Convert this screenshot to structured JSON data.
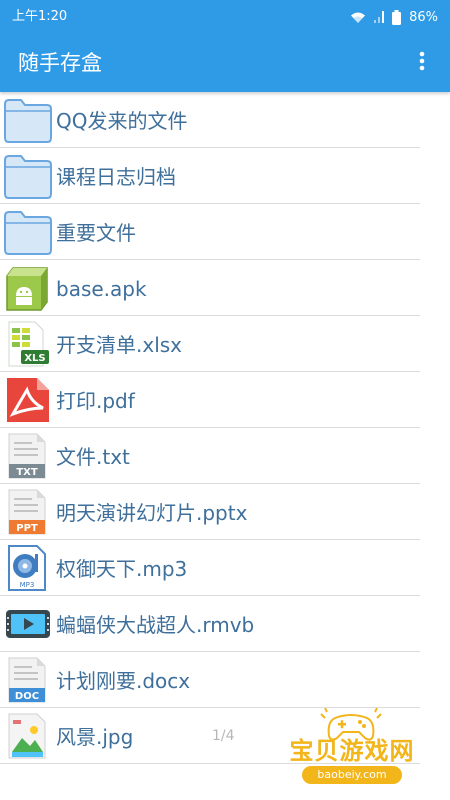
{
  "status_bar": {
    "time": "上午1:20",
    "battery": "86%",
    "icons": [
      "wifi-icon",
      "signal-icon",
      "battery-icon"
    ]
  },
  "app_bar": {
    "title": "随手存盒",
    "menu_icon": "more-vert-icon"
  },
  "files": [
    {
      "name": "QQ发来的文件",
      "icon": "folder"
    },
    {
      "name": "课程日志归档",
      "icon": "folder"
    },
    {
      "name": "重要文件",
      "icon": "folder"
    },
    {
      "name": "base.apk",
      "icon": "apk"
    },
    {
      "name": "开支清单.xlsx",
      "icon": "xls",
      "icon_label": "XLS"
    },
    {
      "name": "打印.pdf",
      "icon": "pdf"
    },
    {
      "name": "文件.txt",
      "icon": "txt",
      "icon_label": "TXT"
    },
    {
      "name": "明天演讲幻灯片.pptx",
      "icon": "ppt",
      "icon_label": "PPT"
    },
    {
      "name": "权御天下.mp3",
      "icon": "mp3",
      "icon_label": "MP3"
    },
    {
      "name": "蝙蝠侠大战超人.rmvb",
      "icon": "video"
    },
    {
      "name": "计划刚要.docx",
      "icon": "doc",
      "icon_label": "DOC"
    },
    {
      "name": "风景.jpg",
      "icon": "image"
    }
  ],
  "page_indicator": "1/4",
  "watermark": {
    "name": "宝贝游戏网",
    "url": "baobeiy.com"
  },
  "colors": {
    "primary": "#2f9be6",
    "file_text": "#3f6f9b",
    "divider": "#dcdcdc",
    "watermark": "#f2b51a"
  }
}
